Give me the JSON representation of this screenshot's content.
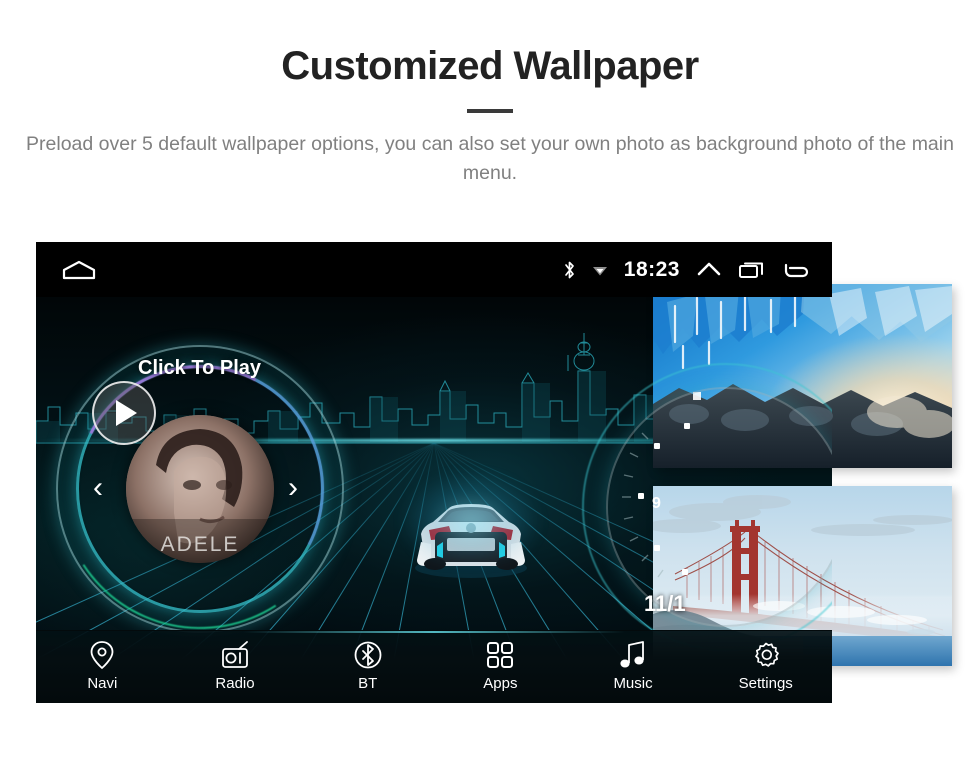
{
  "promo": {
    "title": "Customized Wallpaper",
    "subtitle": "Preload over 5 default wallpaper options, you can also set your own photo as background photo of the main menu.",
    "title_color": "#222222",
    "subtitle_color": "#808080",
    "divider_color": "#3a3a3a"
  },
  "device": {
    "statusbar": {
      "home_icon": "home-icon",
      "bluetooth_icon": "bluetooth-icon",
      "wifi_icon": "wifi-icon",
      "time": "18:23",
      "expand_icon": "chevron-up-icon",
      "recents_icon": "recents-icon",
      "back_icon": "back-icon"
    },
    "home_screen": {
      "media_widget": {
        "hint_label": "Click To Play",
        "artist": "ADELE",
        "play_icon": "play-icon",
        "prev_icon": "chevron-left-icon",
        "next_icon": "chevron-right-icon"
      },
      "gauge_widget": {
        "date": "11/1",
        "tick_label": "9"
      },
      "wallpaper_description": "Shanghai skyline wireframe with BMW i8 on neon perspective grid",
      "accent_color": "#3cd2dc",
      "background_color": "#02191d"
    },
    "dock": {
      "items": [
        {
          "label": "Navi",
          "icon": "location-pin-icon"
        },
        {
          "label": "Radio",
          "icon": "radio-icon"
        },
        {
          "label": "BT",
          "icon": "bluetooth-circle-icon"
        },
        {
          "label": "Apps",
          "icon": "grid-apps-icon"
        },
        {
          "label": "Music",
          "icon": "music-note-icon"
        },
        {
          "label": "Settings",
          "icon": "gear-icon"
        }
      ]
    }
  },
  "wallpaper_thumbnails": [
    {
      "name": "ice-cave-wallpaper",
      "description": "Blue glacier ice cave with warm sunlight"
    },
    {
      "name": "golden-gate-wallpaper",
      "description": "Golden Gate Bridge above fog at dusk"
    }
  ]
}
